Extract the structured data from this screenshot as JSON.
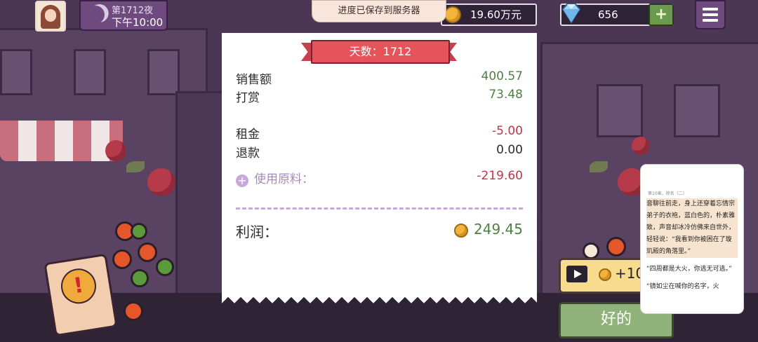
{
  "hud": {
    "night_label": "第1712夜",
    "time_label": "下午10:00",
    "save_toast": "进度已保存到服务器",
    "money": "19.60万元",
    "gems": "656",
    "gem_plus": "+"
  },
  "receipt": {
    "banner": "天数：1712",
    "rows": [
      {
        "label": "销售额",
        "value": "400.57"
      },
      {
        "label": "打赏",
        "value": "73.48"
      },
      {
        "label": "租金",
        "value": "-5.00"
      },
      {
        "label": "退款",
        "value": "0.00"
      }
    ],
    "ingredients_label": "使用原料：",
    "ingredients_value": "-219.60",
    "profit_label": "利润：",
    "profit_value": "249.45"
  },
  "ad_reward_label": "+10",
  "ok_button": "好的",
  "reader": {
    "header": "第10章，除名（二）",
    "paragraphs": [
      "音聊往前走，身上还穿着忘情宗弟子的衣袍，蓝白色的，朴素雅致，声音却冰冷仿佛来自世外，轻轻说：“我看到你被困在了璇玑殿的角落里。”",
      "“四周都是大火，你逃无可逃。”",
      "“镜如尘在喊你的名字，火"
    ]
  },
  "colors": {
    "profit_green": "#4f7f44",
    "negative_red": "#b9384a",
    "banner_red": "#e6535b",
    "ok_green": "#8fb37a"
  }
}
